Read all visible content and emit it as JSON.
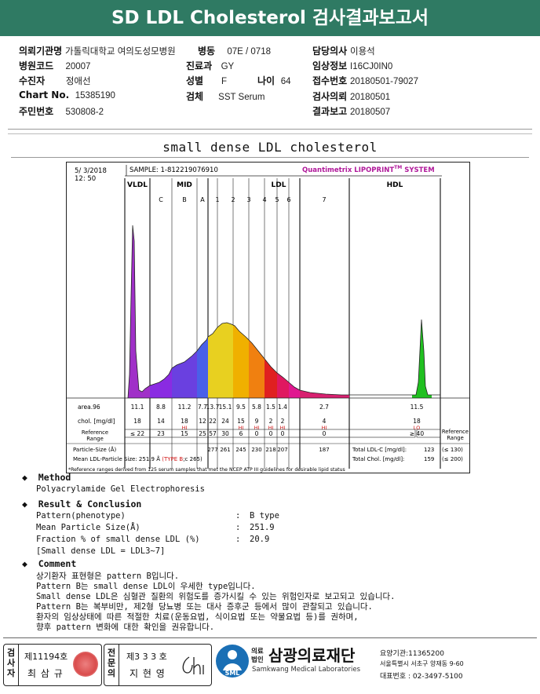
{
  "title": "SD LDL Cholesterol 검사결과보고서",
  "info": {
    "rows": [
      [
        {
          "label": "의뢰기관명",
          "value": "가톨릭대학교 여의도성모병원"
        },
        {
          "label": "병동",
          "value": "07E / 0718"
        },
        {
          "label": "담당의사",
          "value": "이용석"
        }
      ],
      [
        {
          "label": "병원코드",
          "value": "20007"
        },
        {
          "label": "진료과",
          "value": "GY"
        },
        {
          "label": "임상정보",
          "value": "I16CJ0IN0"
        }
      ],
      [
        {
          "label": "수진자",
          "value": "정애선"
        },
        {
          "label": "성별",
          "value": "F"
        },
        {
          "label": "나이",
          "value": "64"
        },
        {
          "label": "접수번호",
          "value": "20180501-79027"
        }
      ],
      [
        {
          "label": "Chart No.",
          "value": "15385190"
        },
        {
          "label": "검체",
          "value": "SST Serum"
        },
        {
          "label": "검사의뢰",
          "value": "20180501"
        }
      ],
      [
        {
          "label": "주민번호",
          "value": "530808-2"
        },
        {
          "label": "결과보고",
          "value": "20180507"
        }
      ]
    ]
  },
  "report_title": "small dense LDL cholesterol",
  "chart_header": {
    "date": "5/ 3/2018",
    "time": "12: 50",
    "sample": "SAMPLE:  1-812219076910",
    "brand": "Quantimetrix LIPOPRINT",
    "brand_tm": "TM",
    "brand_suffix": " SYSTEM"
  },
  "chart_data": {
    "type": "area",
    "title": "small dense LDL cholesterol",
    "zones": [
      "VLDL",
      "MID",
      "LDL",
      "HDL"
    ],
    "subbands": [
      "C",
      "B",
      "A",
      "1",
      "2",
      "3",
      "4",
      "5",
      "6",
      "7"
    ],
    "area_label": "area.96",
    "area": [
      "11.1",
      "8.8",
      "11.2",
      "7.7",
      "13.7",
      "15.1",
      "9.5",
      "5.8",
      "1.5",
      "1.4",
      "2.7",
      "11.5"
    ],
    "chol_label": "chol. [mg/dl]",
    "chol": [
      "18",
      "14",
      "18",
      "12",
      "22",
      "24",
      "15",
      "9",
      "2",
      "2",
      "4",
      "18"
    ],
    "flags": [
      "",
      "",
      "HI",
      "",
      "",
      "",
      "HI",
      "HI",
      "HI",
      "HI",
      "HI",
      "LO"
    ],
    "reference_label": "Reference Range",
    "reference": [
      "≤ 22",
      "23",
      "15",
      "25",
      "57",
      "30",
      "6",
      "0",
      "0",
      "0",
      "0",
      "≥ 40"
    ],
    "reference_right": "Reference Range",
    "particle_size_label": "Particle-Size (Å)",
    "particle_size": [
      "277",
      "261",
      "245",
      "230",
      "218",
      "207",
      "187"
    ],
    "mean_label": "Mean LDL-Particle Size:  251.9 Å",
    "mean_type": "(TYPE B",
    "mean_type_suffix": ";c 265)",
    "total_ldl_label": "Total LDL-C [mg/dl]:",
    "total_ldl_value": "123",
    "total_ldl_ref": "(≤ 130)",
    "total_chol_label": "Total Chol. [mg/dl]:",
    "total_chol_value": "159",
    "total_chol_ref": "(≤ 200)",
    "footnote": "*Reference ranges derived from 125 serum samples that met the NCEP ATP III guidelines for desirable lipid status",
    "colors": {
      "vldl": "#a030c8",
      "mid_c": "#8a2be2",
      "mid_b": "#6a40e0",
      "mid_a": "#4a60e8",
      "ldl1": "#e8d020",
      "ldl2": "#f0b000",
      "ldl3": "#f08010",
      "ldl4": "#e02020",
      "ldl5": "#e01860",
      "ldl6": "#e01890",
      "ldl7": "#d82070",
      "hdl": "#20c020"
    }
  },
  "method": {
    "heading": "Method",
    "text": "Polyacrylamide Gel Electrophoresis"
  },
  "result": {
    "heading": "Result & Conclusion",
    "rows": [
      {
        "label": "Pattern(phenotype)",
        "value": "B type"
      },
      {
        "label": "Mean Particle Size(Å)",
        "value": "251.9"
      },
      {
        "label": "Fraction % of small dense LDL (%)",
        "value": "20.9"
      }
    ],
    "note": "[Small dense LDL = LDL3~7]"
  },
  "comment": {
    "heading": "Comment",
    "lines": [
      "상기환자 표현형은 pattern B입니다.",
      "Pattern B는 small dense LDL이 우세한 type입니다.",
      "Small dense LDL은 심혈관 질환의 위험도를 증가시킬 수 있는 위험인자로 보고되고 있습니다.",
      "Pattern B는 복부비만, 제2형 당뇨병 또는 대사 증후군 등에서 많이 관찰되고 있습니다.",
      "환자의 임상상태에 따른 적절한 치료(운동요법, 식이요법 또는 약물요법 등)를 권하며,",
      "향후 pattern 변화에 대한 확인을 권유합니다."
    ]
  },
  "footer": {
    "checker_label": "검사자",
    "checker_no": "제11194호",
    "checker_name": "최 삼 규",
    "specialist_label": "전문의",
    "specialist_no": "제3 3 3 호",
    "specialist_name": "지 현 영",
    "logo_text": "SML",
    "org_prefix_top": "의료",
    "org_prefix_bottom": "법인",
    "org_name": "삼광의료재단",
    "org_english": "Samkwang Medical Laboratories",
    "code_line": "요양기관:11365200",
    "address_line": "서울특별시 서초구 양재동 9-60",
    "phone_line": "대표번호 : 02-3497-5100"
  }
}
